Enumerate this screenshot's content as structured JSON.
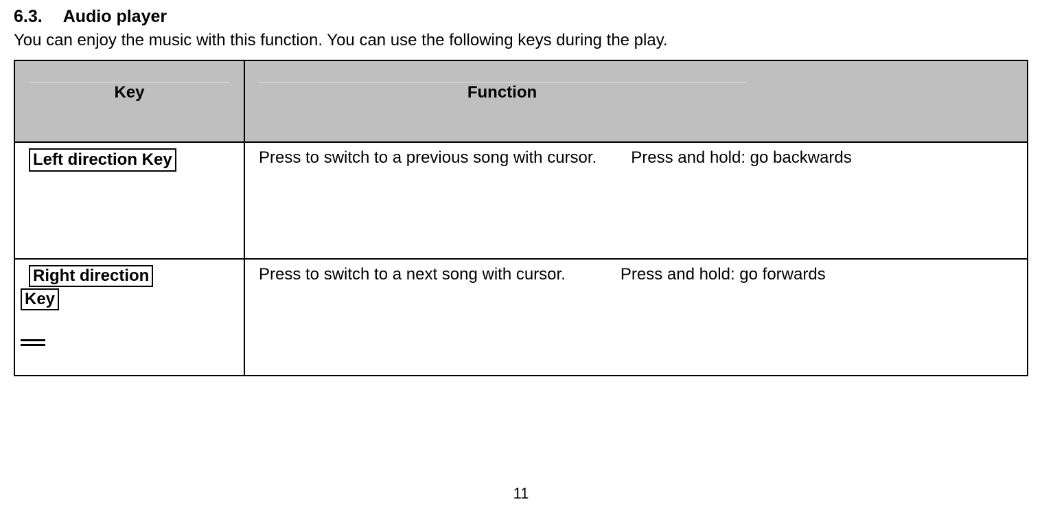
{
  "section": {
    "number": "6.3.",
    "title": "Audio player"
  },
  "intro": "You can enjoy the music with this function. You can use the following keys during the play.",
  "table": {
    "headers": {
      "key": "Key",
      "function": "Function"
    },
    "rows": [
      {
        "key_label": "Left direction Key",
        "key_is_split": false,
        "function_press": "Press to switch to a previous song with cursor.",
        "function_hold": "Press and hold: go backwards"
      },
      {
        "key_label_line1": "Right direction",
        "key_label_line2": "Key",
        "key_is_split": true,
        "function_press": "Press to switch to a next song with cursor.",
        "function_hold": "Press and hold: go forwards"
      }
    ]
  },
  "page_number": "11"
}
